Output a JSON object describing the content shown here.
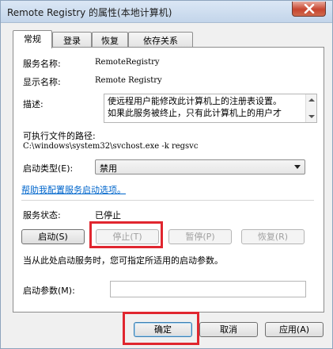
{
  "window": {
    "title": "Remote Registry 的属性(本地计算机)"
  },
  "tabs": [
    {
      "label": "常规",
      "active": true
    },
    {
      "label": "登录",
      "active": false
    },
    {
      "label": "恢复",
      "active": false
    },
    {
      "label": "依存关系",
      "active": false
    }
  ],
  "general": {
    "service_name_label": "服务名称:",
    "service_name_value": "RemoteRegistry",
    "display_name_label": "显示名称:",
    "display_name_value": "Remote Registry",
    "description_label": "描述:",
    "description_line1": "使远程用户能修改此计算机上的注册表设置。",
    "description_line2": "如果此服务被终止，只有此计算机上的用户才",
    "exe_path_label": "可执行文件的路径:",
    "exe_path_value": "C:\\windows\\system32\\svchost.exe -k regsvc",
    "startup_type_label": "启动类型(E):",
    "startup_type_value": "禁用",
    "help_link": "帮助我配置服务启动选项。",
    "service_status_label": "服务状态:",
    "service_status_value": "已停止",
    "start_button": "启动(S)",
    "stop_button": "停止(T)",
    "pause_button": "暂停(P)",
    "resume_button": "恢复(R)",
    "hint_text": "当从此处启动服务时，您可指定所适用的启动参数。",
    "start_params_label": "启动参数(M):",
    "start_params_value": ""
  },
  "footer": {
    "ok_button": "确定",
    "cancel_button": "取消",
    "apply_button": "应用(A)"
  },
  "colors": {
    "highlight": "#e0262f",
    "link": "#0066cc",
    "close_button": "#c7452f"
  }
}
